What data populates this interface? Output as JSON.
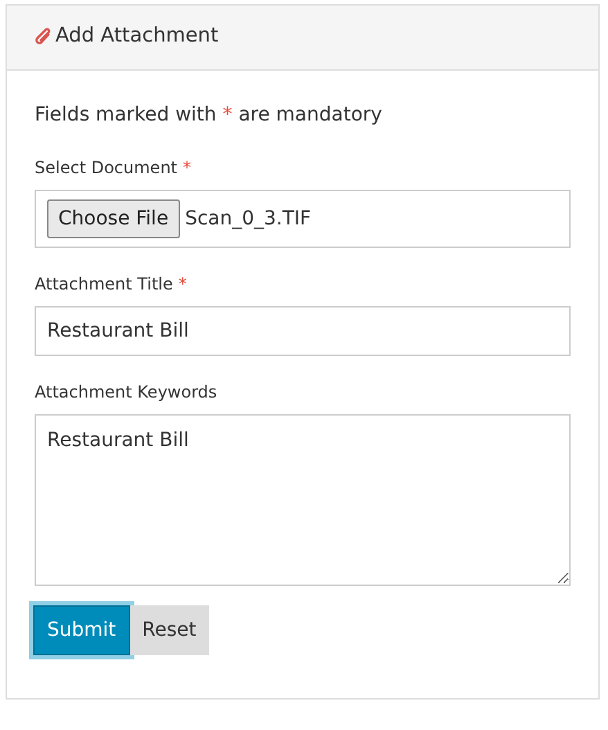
{
  "panel": {
    "title": "Add Attachment"
  },
  "note": {
    "before": "Fields marked with",
    "mark": "*",
    "after": "are mandatory"
  },
  "fields": [
    {
      "kind": "file",
      "label": "Select Document",
      "required": true,
      "button_label": "Choose File",
      "value": "Scan_0_3.TIF"
    },
    {
      "kind": "text",
      "label": "Attachment Title",
      "required": true,
      "value": "Restaurant Bill"
    },
    {
      "kind": "textarea",
      "label": "Attachment Keywords",
      "required": false,
      "value": "Restaurant Bill"
    }
  ],
  "buttons": [
    {
      "kind": "primary",
      "label": "Submit",
      "focused": true
    },
    {
      "kind": "secondary",
      "label": "Reset",
      "focused": false
    }
  ]
}
